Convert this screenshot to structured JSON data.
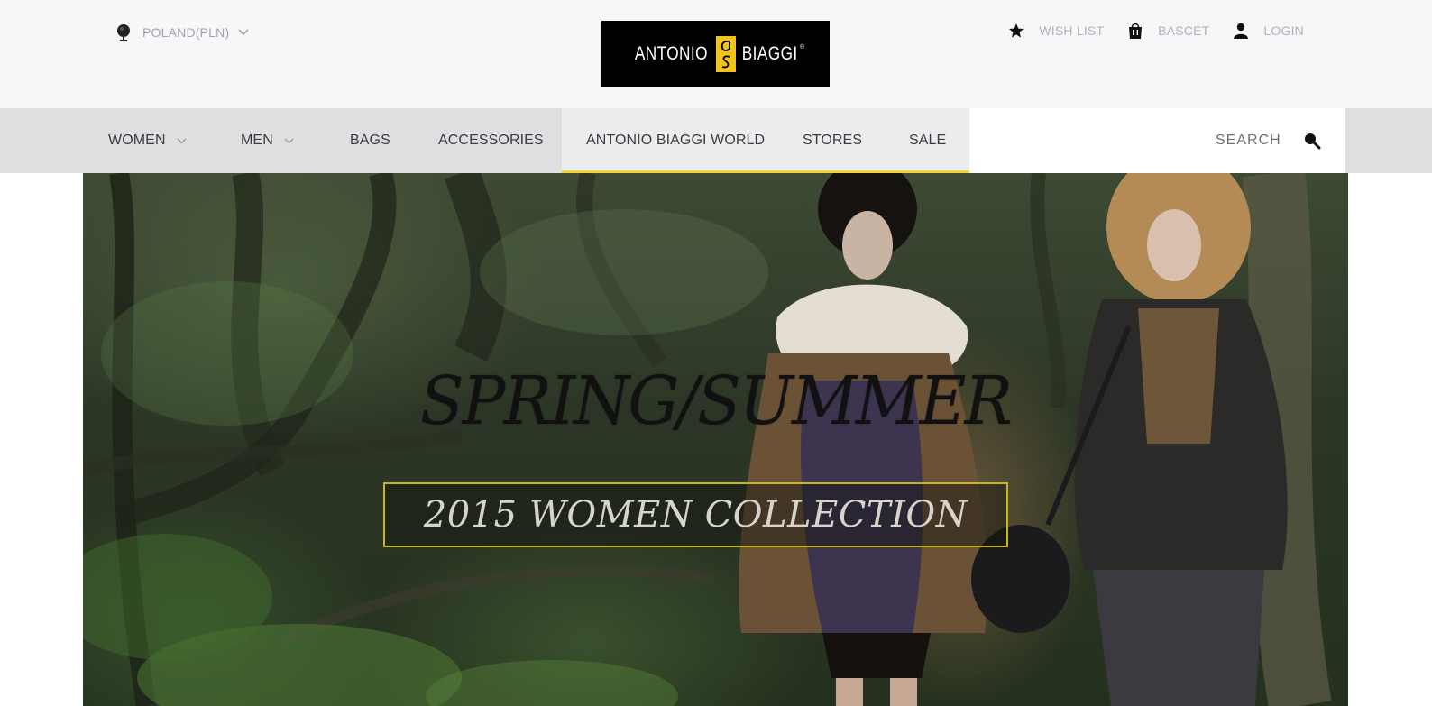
{
  "header": {
    "region_label": "POLAND(PLN)",
    "logo": {
      "word_left": "ANTONIO",
      "word_right": "BIAGGI",
      "registered": "®"
    },
    "utility_links": [
      {
        "label": "WISH LIST",
        "icon": "star-icon"
      },
      {
        "label": "BASCET",
        "icon": "basket-icon"
      },
      {
        "label": "LOGIN",
        "icon": "user-icon"
      }
    ]
  },
  "nav": {
    "items": [
      {
        "label": "WOMEN",
        "has_dropdown": true
      },
      {
        "label": "MEN",
        "has_dropdown": true
      },
      {
        "label": "BAGS",
        "has_dropdown": false
      },
      {
        "label": "ACCESSORIES",
        "has_dropdown": false
      },
      {
        "label": "ANTONIO BIAGGI WORLD",
        "has_dropdown": false,
        "active": true
      },
      {
        "label": "STORES",
        "has_dropdown": false
      },
      {
        "label": "SALE",
        "has_dropdown": false
      }
    ],
    "search_label": "SEARCH",
    "search_icon": "search-icon"
  },
  "hero": {
    "title": "SPRING/SUMMER",
    "subtitle": "2015 WOMEN COLLECTION"
  },
  "colors": {
    "accent_yellow": "#f2d72f",
    "nav_grey": "#dedfe1",
    "topbar_bg": "#f6f7f9",
    "logo_bg": "#000000"
  }
}
